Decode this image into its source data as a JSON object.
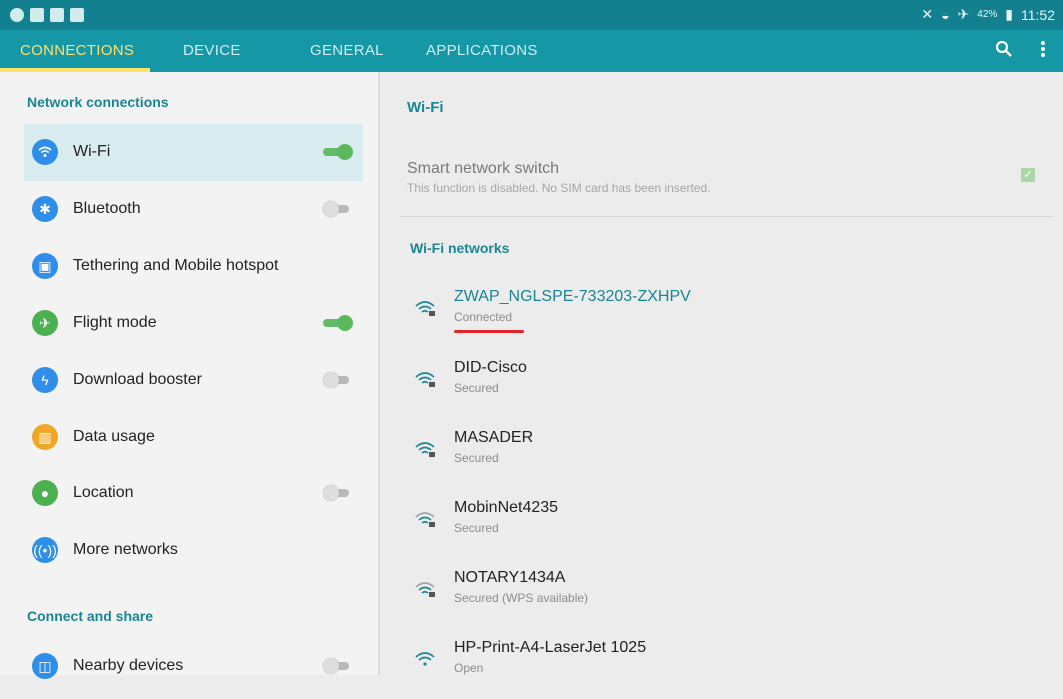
{
  "status_bar": {
    "battery": "42%",
    "time": "11:52"
  },
  "tabs": [
    {
      "label": "CONNECTIONS",
      "active": true
    },
    {
      "label": "DEVICE",
      "active": false
    },
    {
      "label": "GENERAL",
      "active": false
    },
    {
      "label": "APPLICATIONS",
      "active": false
    }
  ],
  "toolbar": {
    "search_icon": "search-icon",
    "menu_icon": "more-vert-icon"
  },
  "left": {
    "section_network": "Network connections",
    "items": [
      {
        "label": "Wi-Fi",
        "icon": "wifi-icon",
        "toggle": true,
        "selected": true
      },
      {
        "label": "Bluetooth",
        "icon": "bluetooth-icon",
        "toggle": false
      },
      {
        "label": "Tethering and Mobile hotspot",
        "icon": "hotspot-icon"
      },
      {
        "label": "Flight mode",
        "icon": "airplane-icon",
        "toggle": true
      },
      {
        "label": "Download booster",
        "icon": "bolt-icon",
        "toggle": false
      },
      {
        "label": "Data usage",
        "icon": "chart-icon"
      },
      {
        "label": "Location",
        "icon": "location-icon",
        "toggle": false
      },
      {
        "label": "More networks",
        "icon": "antenna-icon"
      }
    ],
    "section_share": "Connect and share",
    "share_items": [
      {
        "label": "Nearby devices",
        "icon": "nearby-icon",
        "toggle": false
      }
    ]
  },
  "right": {
    "title": "Wi-Fi",
    "smart_switch": {
      "title": "Smart network switch",
      "subtitle": "This function is disabled. No SIM card has been inserted.",
      "checked": true
    },
    "networks_header": "Wi-Fi networks",
    "networks": [
      {
        "name": "ZWAP_NGLSPE-733203-ZXHPV",
        "status": "Connected",
        "connected": true
      },
      {
        "name": "DID-Cisco",
        "status": "Secured"
      },
      {
        "name": "MASADER",
        "status": "Secured"
      },
      {
        "name": "MobinNet4235",
        "status": "Secured"
      },
      {
        "name": "NOTARY1434A",
        "status": "Secured (WPS available)"
      },
      {
        "name": "HP-Print-A4-LaserJet 1025",
        "status": "Open"
      }
    ]
  }
}
